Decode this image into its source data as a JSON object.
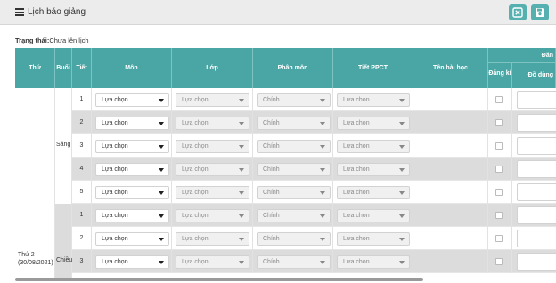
{
  "header": {
    "title": "Lịch báo giảng",
    "icons": {
      "title": "list-icon",
      "cancel": "close-icon",
      "save": "save-icon"
    },
    "button_color": "#56b0b0"
  },
  "status": {
    "label": "Trạng thái:",
    "value": "Chưa lên lịch"
  },
  "table": {
    "header_color": "#4aa6a4",
    "columns": {
      "thu": "Thứ",
      "buoi": "Buổi",
      "tiet": "Tiết",
      "mon": "Môn",
      "lop": "Lớp",
      "phan_mon": "Phân môn",
      "tiet_ppct": "Tiết PPCT",
      "ten_bai_hoc": "Tên bài học",
      "group_right": "Đăn",
      "dang_ki": "Đăng kí",
      "do_dung": "Đồ dùng"
    },
    "day": {
      "name": "Thứ 2",
      "date": "(30/08/2021)"
    },
    "sessions": {
      "sang": "Sáng",
      "chieu": "Chiều"
    },
    "rows": [
      {
        "tiet": "1",
        "mon": "Lựa chọn",
        "lop": "Lựa chọn",
        "phan_mon": "Chính",
        "tiet_ppct": "Lựa chọn"
      },
      {
        "tiet": "2",
        "mon": "Lựa chọn",
        "lop": "Lựa chọn",
        "phan_mon": "Chính",
        "tiet_ppct": "Lựa chọn"
      },
      {
        "tiet": "3",
        "mon": "Lựa chọn",
        "lop": "Lựa chọn",
        "phan_mon": "Chính",
        "tiet_ppct": "Lựa chọn"
      },
      {
        "tiet": "4",
        "mon": "Lựa chọn",
        "lop": "Lựa chọn",
        "phan_mon": "Chính",
        "tiet_ppct": "Lựa chọn"
      },
      {
        "tiet": "5",
        "mon": "Lựa chọn",
        "lop": "Lựa chọn",
        "phan_mon": "Chính",
        "tiet_ppct": "Lựa chọn"
      },
      {
        "tiet": "1",
        "mon": "Lựa chọn",
        "lop": "Lựa chọn",
        "phan_mon": "Chính",
        "tiet_ppct": "Lựa chọn"
      },
      {
        "tiet": "2",
        "mon": "Lựa chọn",
        "lop": "Lựa chọn",
        "phan_mon": "Chính",
        "tiet_ppct": "Lựa chọn"
      },
      {
        "tiet": "3",
        "mon": "Lựa chọn",
        "lop": "Lựa chọn",
        "phan_mon": "Chính",
        "tiet_ppct": "Lựa chọn"
      }
    ]
  }
}
